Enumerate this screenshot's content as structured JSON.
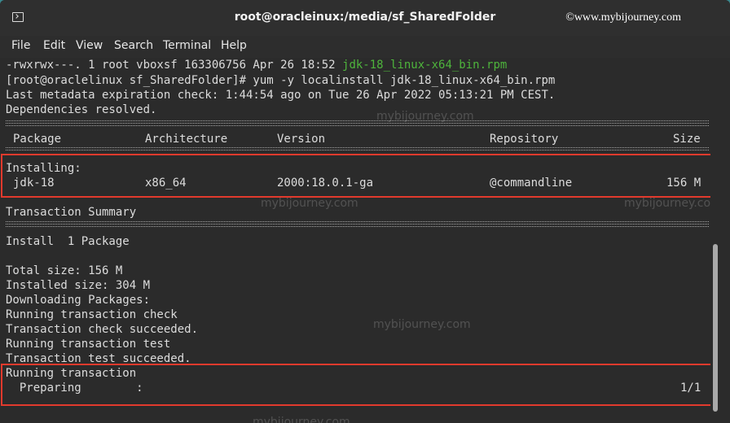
{
  "window": {
    "title": "root@oracleinux:/media/sf_SharedFolder",
    "watermark": "©www.mybijourney.com"
  },
  "menu": [
    "File",
    "Edit",
    "View",
    "Search",
    "Terminal",
    "Help"
  ],
  "terminal": {
    "line1_prefix": "-rwxrwx---. 1 root vboxsf 163306756 Apr 26 18:52 ",
    "line1_file": "jdk-18_linux-x64_bin.rpm",
    "line2": "[root@oraclelinux sf_SharedFolder]# yum -y localinstall jdk-18_linux-x64_bin.rpm",
    "line3": "Last metadata expiration check: 1:44:54 ago on Tue 26 Apr 2022 05:13:21 PM CEST.",
    "line4": "Dependencies resolved.",
    "table_headers": {
      "package": "Package",
      "architecture": "Architecture",
      "version": "Version",
      "repository": "Repository",
      "size": "Size"
    },
    "installing_label": "Installing:",
    "row": {
      "package": "jdk-18",
      "architecture": "x86_64",
      "version": "2000:18.0.1-ga",
      "repository": "@commandline",
      "size": "156 M"
    },
    "transaction_summary": "Transaction Summary",
    "install_count": "Install  1 Package",
    "total_size": "Total size: 156 M",
    "installed_size": "Installed size: 304 M",
    "downloading": "Downloading Packages:",
    "check": "Running transaction check",
    "check_ok": "Transaction check succeeded.",
    "test": "Running transaction test",
    "test_ok": "Transaction test succeeded.",
    "running": "Running transaction",
    "preparing": "  Preparing        :",
    "preparing_progress": "1/1"
  },
  "watermarks": {
    "w1": "mybijourney.com",
    "w2": "mybijourney.com",
    "w3": "mybijourney.com",
    "w4": "mybijourney.com",
    "w5": "mybijourney.com"
  },
  "colors": {
    "highlight": "#e23a2d",
    "green_text": "#4eb43c"
  }
}
